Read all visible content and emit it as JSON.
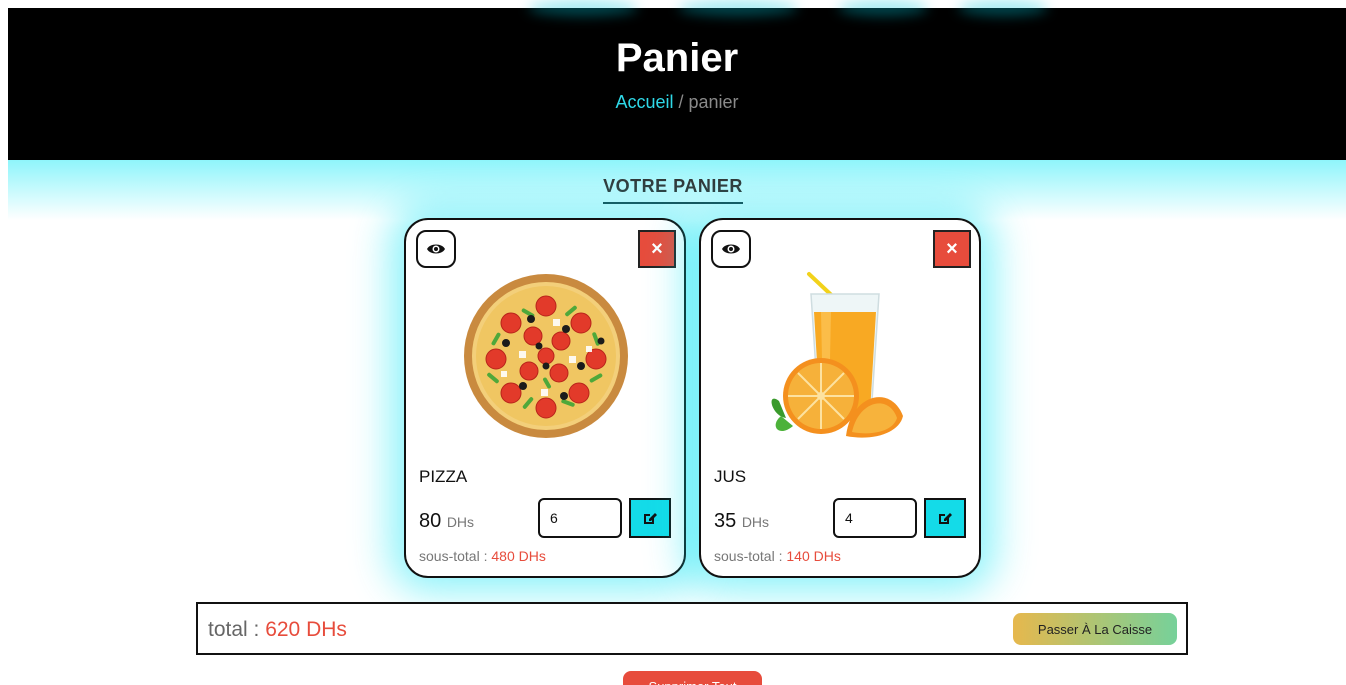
{
  "header": {
    "title": "Panier",
    "breadcrumb_home": "Accueil",
    "breadcrumb_separator": " / ",
    "breadcrumb_current": "panier"
  },
  "section": {
    "title": "VOTRE PANIER"
  },
  "cart_items": [
    {
      "name": "PIZZA",
      "price": "80",
      "currency": "DHs",
      "quantity": "6",
      "subtotal_label": "sous-total : ",
      "subtotal_value": "480 DHs",
      "image": "pizza-image",
      "delete_glyph": "×"
    },
    {
      "name": "JUS",
      "price": "35",
      "currency": "DHs",
      "quantity": "4",
      "subtotal_label": "sous-total : ",
      "subtotal_value": "140 DHs",
      "image": "orange-juice-image",
      "delete_glyph": "×"
    }
  ],
  "summary": {
    "total_label": "total : ",
    "total_value": "620 DHs",
    "checkout_label": "Passer À La Caisse"
  },
  "actions": {
    "clear_label": "Supprimer Tout"
  },
  "colors": {
    "accent": "#14dbe8",
    "danger": "#e74c3c",
    "header_bg": "#000000",
    "breadcrumb_link": "#2fd9e8"
  },
  "icons": {
    "view": "eye-icon",
    "delete": "close-icon",
    "edit": "edit-icon"
  }
}
